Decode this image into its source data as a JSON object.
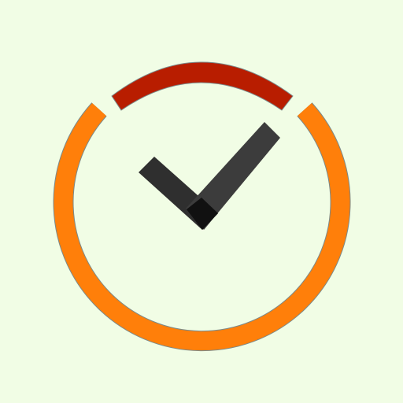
{
  "app_icon": {
    "name": "clock-checkmark-app-icon",
    "colors": {
      "background": "#f1fde5",
      "top_arc": "#b81d00",
      "ring": "#ff7f0a",
      "ring_stroke": "#7a8a8a",
      "check_short": "#2f2f2f",
      "check_long": "#3c3c3c",
      "check_joint": "#111111"
    }
  }
}
